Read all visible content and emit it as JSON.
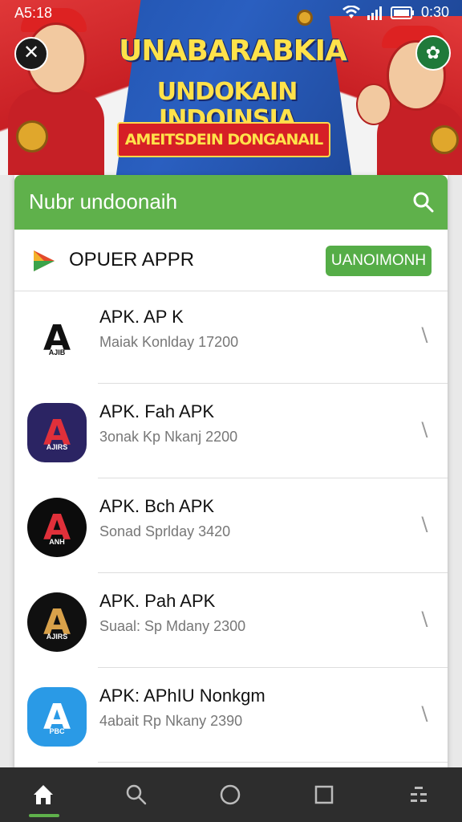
{
  "status_bar": {
    "time": "A5:18",
    "clock_right": "0:30"
  },
  "banner": {
    "title": "UNABARABKIA",
    "subtitle": "UNDOKAIN INDOINSIA",
    "ribbon": "AMEITSDEIN DONGANAIL"
  },
  "search": {
    "text": "Nubr undoonaih",
    "icon": "search-icon"
  },
  "section": {
    "title": "OPUER APPR",
    "button": "UANOIMONH"
  },
  "apps": [
    {
      "name": "APK. AP K",
      "meta": "Maiak Konlday 17200",
      "icon_letter": "A",
      "icon_tag": "AJIB",
      "bg": "#ffffff",
      "fg": "#111111"
    },
    {
      "name": "APK. Fah APK",
      "meta": "3onak Kp Nkanj 2200",
      "icon_letter": "A",
      "icon_tag": "AJIRS",
      "bg": "#2b2463",
      "fg": "#e0303a"
    },
    {
      "name": "APK. Bch APK",
      "meta": "Sonad Sprlday 3420",
      "icon_letter": "A",
      "icon_tag": "ANH",
      "bg": "#0c0c0c",
      "fg": "#e0303a"
    },
    {
      "name": "APK. Pah APK",
      "meta": "Suaal: Sp Mdany 2300",
      "icon_letter": "A",
      "icon_tag": "AJIRS",
      "bg": "#101010",
      "fg": "#d8a14a"
    },
    {
      "name": "APK: APhIU Nonkgm",
      "meta": "4abait Rp Nkany 2390",
      "icon_letter": "A",
      "icon_tag": "PBC",
      "bg": "#2a9ae6",
      "fg": "#ffffff"
    }
  ],
  "nav": [
    "home-icon",
    "search-icon",
    "circle-icon",
    "square-icon",
    "menu-icon"
  ],
  "colors": {
    "accent": "#5fb14b",
    "banner_blue": "#1d4fa8",
    "banner_red": "#c81f24"
  }
}
